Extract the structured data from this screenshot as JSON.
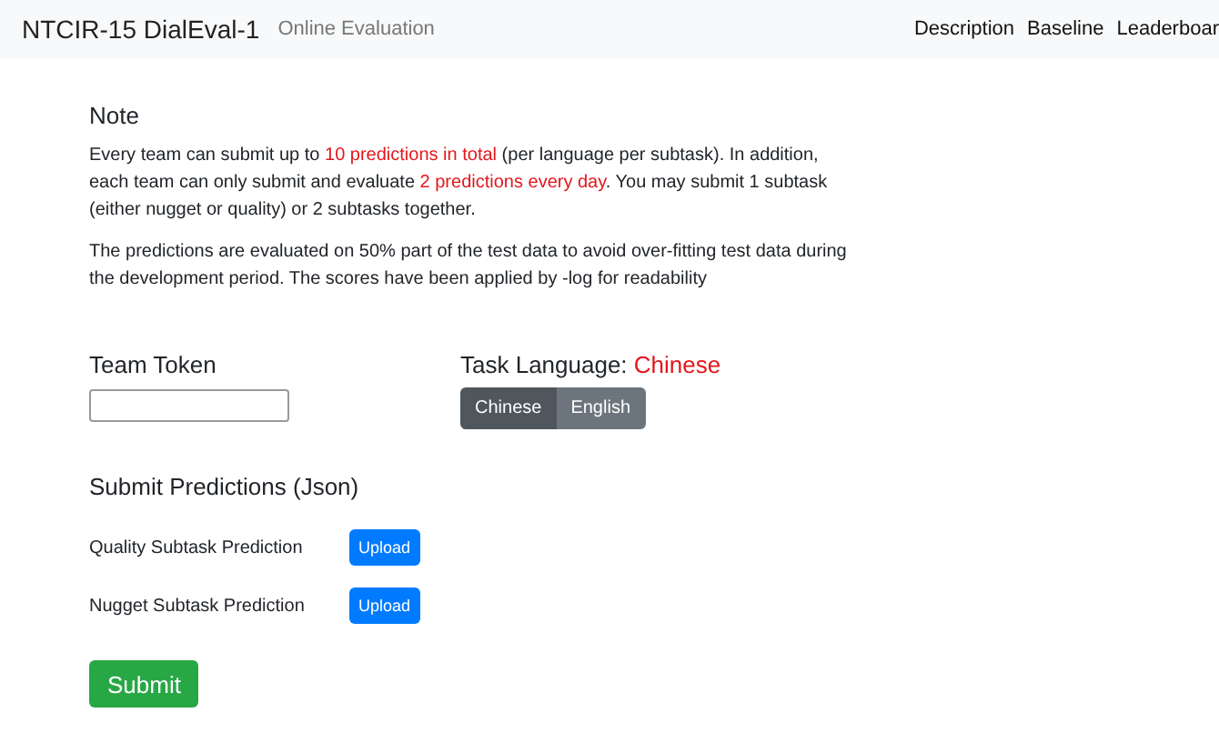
{
  "navbar": {
    "brand": "NTCIR-15 DialEval-1",
    "subtitle": "Online Evaluation",
    "links": [
      "Description",
      "Baseline",
      "Leaderboar"
    ]
  },
  "note": {
    "title": "Note",
    "paragraphs": [
      [
        {
          "text": "Every team can submit up to ",
          "highlight": false
        },
        {
          "text": "10 predictions in total",
          "highlight": true
        },
        {
          "text": " (per language per subtask). In addition, each team can only submit and evaluate ",
          "highlight": false
        },
        {
          "text": "2 predictions every day",
          "highlight": true
        },
        {
          "text": ". You may submit 1 subtask (either nugget or quality) or 2 subtasks together.",
          "highlight": false
        }
      ],
      [
        {
          "text": "The predictions are evaluated on 50% part of the test data to avoid over-fitting test data during the development period. The scores have been applied by -log for readability",
          "highlight": false
        }
      ]
    ]
  },
  "team_token": {
    "label": "Team Token"
  },
  "task_language": {
    "label": "Task Language: ",
    "value": "Chinese",
    "options": [
      {
        "label": "Chinese",
        "selected": true
      },
      {
        "label": "English",
        "selected": false
      }
    ]
  },
  "submit_predictions": {
    "title": "Submit Predictions (Json)",
    "rows": [
      {
        "label": "Quality Subtask Prediction",
        "button": "Upload"
      },
      {
        "label": "Nugget Subtask Prediction",
        "button": "Upload"
      }
    ]
  },
  "submit_button": "Submit"
}
